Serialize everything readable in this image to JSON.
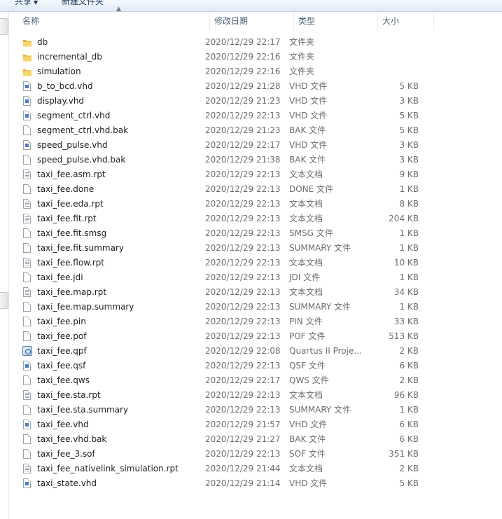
{
  "toolbar": {
    "share_label": "共享",
    "new_folder_label": "新建文件夹"
  },
  "columns": {
    "name": "名称",
    "date": "修改日期",
    "type": "类型",
    "size": "大小"
  },
  "files": [
    {
      "name": "db",
      "date": "2020/12/29 22:17",
      "type": "文件夹",
      "size": "",
      "icon": "folder-icon"
    },
    {
      "name": "incremental_db",
      "date": "2020/12/29 22:16",
      "type": "文件夹",
      "size": "",
      "icon": "folder-icon"
    },
    {
      "name": "simulation",
      "date": "2020/12/29 22:16",
      "type": "文件夹",
      "size": "",
      "icon": "folder-icon"
    },
    {
      "name": "b_to_bcd.vhd",
      "date": "2020/12/29 21:28",
      "type": "VHD 文件",
      "size": "5 KB",
      "icon": "vhd-file-icon"
    },
    {
      "name": "display.vhd",
      "date": "2020/12/29 21:23",
      "type": "VHD 文件",
      "size": "3 KB",
      "icon": "vhd-file-icon"
    },
    {
      "name": "segment_ctrl.vhd",
      "date": "2020/12/29 22:13",
      "type": "VHD 文件",
      "size": "5 KB",
      "icon": "vhd-file-icon"
    },
    {
      "name": "segment_ctrl.vhd.bak",
      "date": "2020/12/29 21:23",
      "type": "BAK 文件",
      "size": "5 KB",
      "icon": "file-icon"
    },
    {
      "name": "speed_pulse.vhd",
      "date": "2020/12/29 22:17",
      "type": "VHD 文件",
      "size": "3 KB",
      "icon": "vhd-file-icon"
    },
    {
      "name": "speed_pulse.vhd.bak",
      "date": "2020/12/29 21:38",
      "type": "BAK 文件",
      "size": "3 KB",
      "icon": "file-icon"
    },
    {
      "name": "taxi_fee.asm.rpt",
      "date": "2020/12/29 22:13",
      "type": "文本文档",
      "size": "9 KB",
      "icon": "text-file-icon"
    },
    {
      "name": "taxi_fee.done",
      "date": "2020/12/29 22:13",
      "type": "DONE 文件",
      "size": "1 KB",
      "icon": "file-icon"
    },
    {
      "name": "taxi_fee.eda.rpt",
      "date": "2020/12/29 22:13",
      "type": "文本文档",
      "size": "8 KB",
      "icon": "text-file-icon"
    },
    {
      "name": "taxi_fee.fit.rpt",
      "date": "2020/12/29 22:13",
      "type": "文本文档",
      "size": "204 KB",
      "icon": "text-file-icon"
    },
    {
      "name": "taxi_fee.fit.smsg",
      "date": "2020/12/29 22:13",
      "type": "SMSG 文件",
      "size": "1 KB",
      "icon": "file-icon"
    },
    {
      "name": "taxi_fee.fit.summary",
      "date": "2020/12/29 22:13",
      "type": "SUMMARY 文件",
      "size": "1 KB",
      "icon": "file-icon"
    },
    {
      "name": "taxi_fee.flow.rpt",
      "date": "2020/12/29 22:13",
      "type": "文本文档",
      "size": "10 KB",
      "icon": "text-file-icon"
    },
    {
      "name": "taxi_fee.jdi",
      "date": "2020/12/29 22:13",
      "type": "JDI 文件",
      "size": "1 KB",
      "icon": "file-icon"
    },
    {
      "name": "taxi_fee.map.rpt",
      "date": "2020/12/29 22:13",
      "type": "文本文档",
      "size": "34 KB",
      "icon": "text-file-icon"
    },
    {
      "name": "taxi_fee.map.summary",
      "date": "2020/12/29 22:13",
      "type": "SUMMARY 文件",
      "size": "1 KB",
      "icon": "file-icon"
    },
    {
      "name": "taxi_fee.pin",
      "date": "2020/12/29 22:13",
      "type": "PIN 文件",
      "size": "33 KB",
      "icon": "file-icon"
    },
    {
      "name": "taxi_fee.pof",
      "date": "2020/12/29 22:13",
      "type": "POF 文件",
      "size": "513 KB",
      "icon": "file-icon"
    },
    {
      "name": "taxi_fee.qpf",
      "date": "2020/12/29 22:08",
      "type": "Quartus II Proje...",
      "size": "2 KB",
      "icon": "quartus-project-icon"
    },
    {
      "name": "taxi_fee.qsf",
      "date": "2020/12/29 22:13",
      "type": "QSF 文件",
      "size": "6 KB",
      "icon": "vhd-file-icon"
    },
    {
      "name": "taxi_fee.qws",
      "date": "2020/12/29 22:17",
      "type": "QWS 文件",
      "size": "2 KB",
      "icon": "file-icon"
    },
    {
      "name": "taxi_fee.sta.rpt",
      "date": "2020/12/29 22:13",
      "type": "文本文档",
      "size": "96 KB",
      "icon": "text-file-icon"
    },
    {
      "name": "taxi_fee.sta.summary",
      "date": "2020/12/29 22:13",
      "type": "SUMMARY 文件",
      "size": "1 KB",
      "icon": "file-icon"
    },
    {
      "name": "taxi_fee.vhd",
      "date": "2020/12/29 21:57",
      "type": "VHD 文件",
      "size": "6 KB",
      "icon": "vhd-file-icon"
    },
    {
      "name": "taxi_fee.vhd.bak",
      "date": "2020/12/29 21:27",
      "type": "BAK 文件",
      "size": "6 KB",
      "icon": "file-icon"
    },
    {
      "name": "taxi_fee_3.sof",
      "date": "2020/12/29 22:13",
      "type": "SOF 文件",
      "size": "351 KB",
      "icon": "file-icon"
    },
    {
      "name": "taxi_fee_nativelink_simulation.rpt",
      "date": "2020/12/29 21:44",
      "type": "文本文档",
      "size": "2 KB",
      "icon": "text-file-icon"
    },
    {
      "name": "taxi_state.vhd",
      "date": "2020/12/29 21:14",
      "type": "VHD 文件",
      "size": "5 KB",
      "icon": "vhd-file-icon"
    }
  ]
}
